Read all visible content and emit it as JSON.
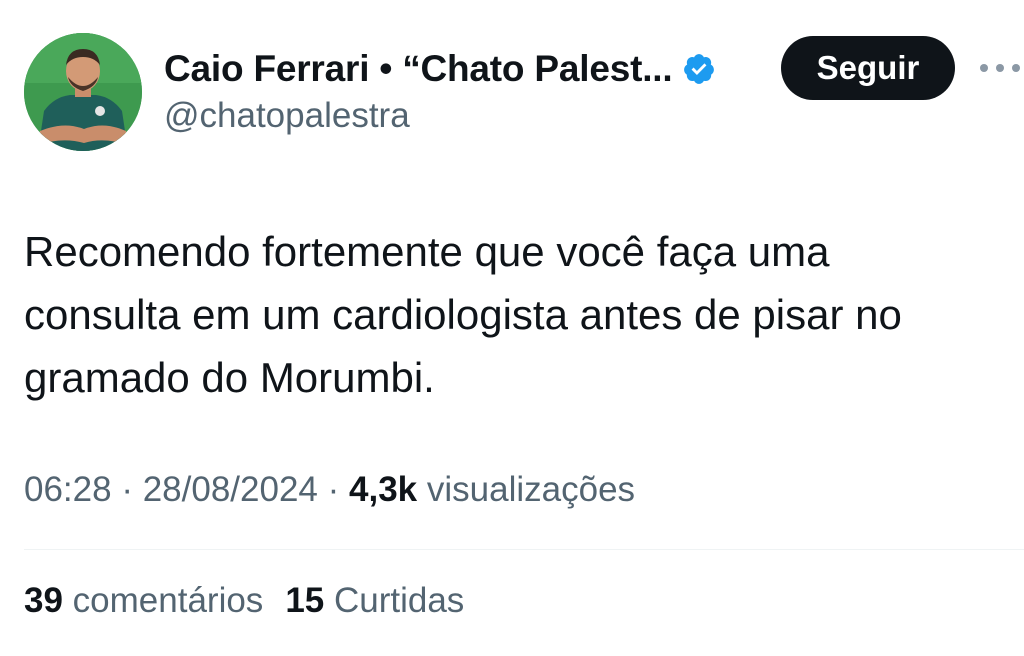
{
  "author": {
    "display_name": "Caio Ferrari • “Chato Palest...",
    "handle": "@chatopalestra",
    "avatar_bg": "#3e9a4f",
    "verified_color": "#1d9bf0"
  },
  "follow_button": {
    "label": "Seguir"
  },
  "tweet": {
    "lines": [
      "Recomendo fortemente que você faça uma",
      "consulta em um cardiologista antes de pisar no",
      "gramado do Morumbi."
    ]
  },
  "meta": {
    "time": "06:28",
    "separator": "·",
    "date": "28/08/2024",
    "views_count": "4,3k",
    "views_label": "visualizações"
  },
  "stats": {
    "comments_count": "39",
    "comments_label": "comentários",
    "likes_count": "15",
    "likes_label": "Curtidas"
  },
  "icons": {
    "verified": "verified-badge-icon",
    "more": "more-options-icon"
  }
}
